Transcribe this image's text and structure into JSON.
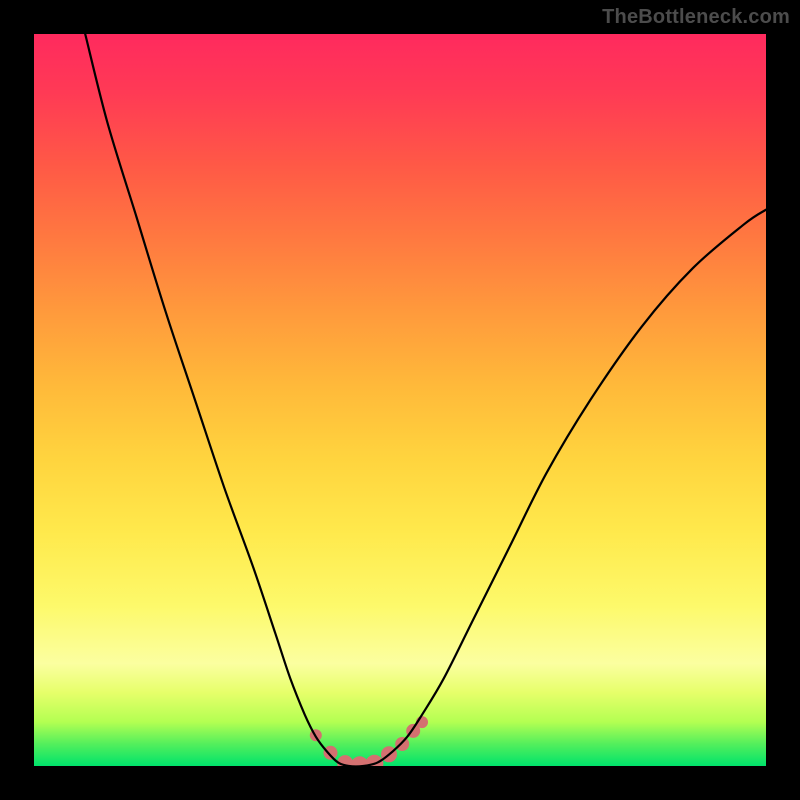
{
  "watermark": "TheBottleneck.com",
  "chart_data": {
    "type": "line",
    "title": "",
    "xlabel": "",
    "ylabel": "",
    "xlim": [
      0,
      100
    ],
    "ylim": [
      0,
      100
    ],
    "grid": false,
    "series": [
      {
        "name": "bottleneck-curve",
        "color": "#000000",
        "x": [
          7,
          10,
          14,
          18,
          22,
          26,
          30,
          33,
          35,
          37,
          38.5,
          40,
          41.5,
          43,
          45,
          47,
          49,
          51,
          53,
          56,
          60,
          65,
          70,
          76,
          83,
          90,
          97,
          100
        ],
        "y": [
          100,
          88,
          75,
          62,
          50,
          38,
          27,
          18,
          12,
          7,
          4,
          2,
          0.5,
          0,
          0,
          0.5,
          2,
          4,
          7,
          12,
          20,
          30,
          40,
          50,
          60,
          68,
          74,
          76
        ]
      }
    ],
    "markers": {
      "name": "highlight-dots",
      "color": "#d47070",
      "points": [
        {
          "x": 38.5,
          "y": 4.2
        },
        {
          "x": 40.5,
          "y": 1.8
        },
        {
          "x": 42.5,
          "y": 0.4
        },
        {
          "x": 44.5,
          "y": 0.1
        },
        {
          "x": 46.5,
          "y": 0.3
        },
        {
          "x": 48.5,
          "y": 1.6
        },
        {
          "x": 50.3,
          "y": 3.0
        },
        {
          "x": 51.8,
          "y": 4.8
        },
        {
          "x": 53.0,
          "y": 6.0
        }
      ],
      "radius_pattern": [
        6,
        7,
        8,
        9,
        9,
        8,
        7,
        7,
        6
      ]
    }
  }
}
